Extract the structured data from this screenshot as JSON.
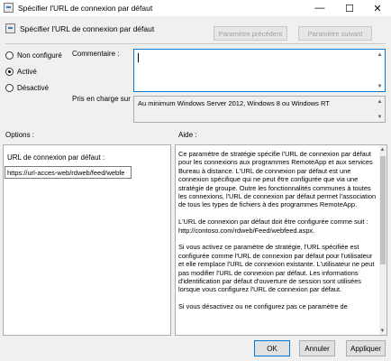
{
  "window": {
    "title": "Spécifier l'URL de connexion par défaut",
    "minimize_icon": "—",
    "maximize_icon": "☐",
    "close_icon": "✕"
  },
  "header": {
    "title": "Spécifier l'URL de connexion par défaut",
    "prev_button": "Paramètre précédent",
    "next_button": "Paramètre suivant"
  },
  "state": {
    "options": [
      {
        "label": "Non configuré",
        "checked": false
      },
      {
        "label": "Activé",
        "checked": true
      },
      {
        "label": "Désactivé",
        "checked": false
      }
    ]
  },
  "comment": {
    "label": "Commentaire :",
    "value": ""
  },
  "supported": {
    "label": "Pris en charge sur :",
    "value": "Au minimum Windows Server 2012, Windows 8 ou Windows RT"
  },
  "options_pane": {
    "label": "Options :",
    "field_label": "URL de connexion par défaut :",
    "field_value": "https://url-acces-web/rdweb/feed/webfe"
  },
  "help_pane": {
    "label": "Aide :",
    "paragraphs": [
      "Ce paramètre de stratégie spécifie l'URL de connexion par défaut pour les connexions aux programmes RemoteApp et aux services Bureau à distance. L'URL de connexion par défaut est une connexion spécifique qui ne peut être configurée que via une stratégie de groupe. Outre les fonctionnalités communes à toutes les connexions, l'URL de connexion par défaut permet l'association de tous les types de fichiers à des programmes RemoteApp.",
      "L'URL de connexion par défaut doit être configurée comme suit : http://contoso.com/rdweb/Feed/webfeed.aspx.",
      "Si vous activez ce paramètre de stratégie, l'URL spécifiée est configurée comme l'URL de connexion par défaut pour l'utilisateur et elle remplace l'URL de connexion existante. L'utilisateur ne peut pas modifier l'URL de connexion par défaut. Les informations d'identification par défaut d'ouverture de session sont utilisées lorsque vous configurez l'URL de connexion par défaut.",
      "Si vous désactivez ou ne configurez pas ce paramètre de"
    ]
  },
  "buttons": {
    "ok": "OK",
    "cancel": "Annuler",
    "apply": "Appliquer"
  }
}
